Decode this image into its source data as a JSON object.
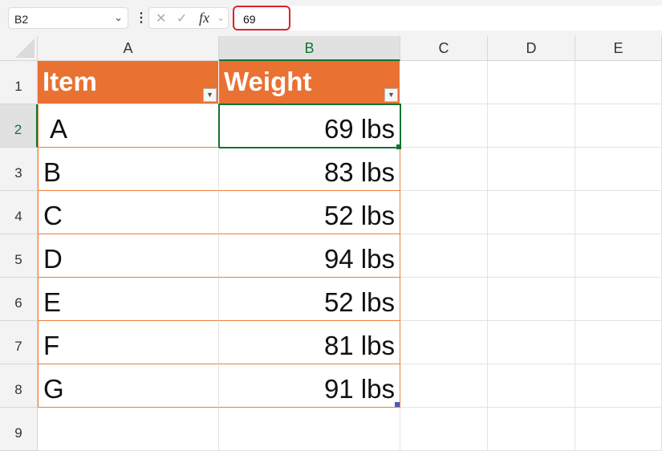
{
  "formula_bar": {
    "name_box": "B2",
    "formula_value": "69",
    "fx_label": "fx"
  },
  "columns": [
    "A",
    "B",
    "C",
    "D",
    "E"
  ],
  "rows": [
    "1",
    "2",
    "3",
    "4",
    "5",
    "6",
    "7",
    "8",
    "9"
  ],
  "table": {
    "headers": [
      "Item",
      "Weight"
    ],
    "items": [
      {
        "item": "A",
        "weight": "69 lbs"
      },
      {
        "item": "B",
        "weight": "83 lbs"
      },
      {
        "item": "C",
        "weight": "52 lbs"
      },
      {
        "item": "D",
        "weight": "94 lbs"
      },
      {
        "item": "E",
        "weight": "52 lbs"
      },
      {
        "item": "F",
        "weight": "81 lbs"
      },
      {
        "item": "G",
        "weight": "91 lbs"
      }
    ]
  },
  "colors": {
    "header": "#e97132",
    "border": "#ee7d3a",
    "selection": "#137333",
    "alert": "#e0202a"
  }
}
